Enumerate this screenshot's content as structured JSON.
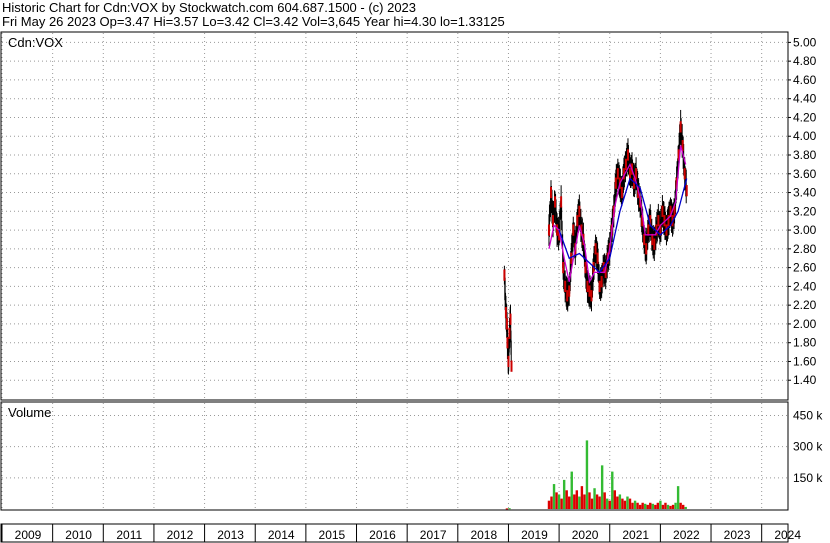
{
  "header": {
    "line1": "Historic Chart for Cdn:VOX by Stockwatch.com 604.687.1500 - (c) 2023",
    "line2": "Fri May 26 2023  Op=3.47  Hi=3.57  Lo=3.42  Cl=3.42  Vol=3,645  Year hi=4.30  lo=1.33125"
  },
  "chart_data": {
    "type": "line",
    "symbol_label": "Cdn:VOX",
    "volume_label": "Volume",
    "price_axis": {
      "ticks": [
        "5.00",
        "4.80",
        "4.60",
        "4.40",
        "4.20",
        "4.00",
        "3.80",
        "3.60",
        "3.40",
        "3.20",
        "3.00",
        "2.80",
        "2.60",
        "2.40",
        "2.20",
        "2.00",
        "1.80",
        "1.60",
        "1.40"
      ],
      "range": [
        1.2,
        5.1
      ]
    },
    "volume_axis": {
      "ticks": [
        "450 k",
        "300 k",
        "150 k"
      ],
      "range": [
        0,
        510000
      ]
    },
    "x_axis": {
      "years": [
        "2009",
        "2010",
        "2011",
        "2012",
        "2013",
        "2014",
        "2015",
        "2016",
        "2017",
        "2018",
        "2019",
        "2020",
        "2021",
        "2022",
        "2023",
        "2024"
      ],
      "range": [
        2009.0,
        2024.5
      ]
    },
    "colors": {
      "price": "#000000",
      "ma_short": "#cc00cc",
      "ma_long": "#0000cc",
      "vol_up": "#33bb33",
      "vol_down": "#dd0000",
      "frame": "#000000",
      "grid": "#999999"
    },
    "series": [
      {
        "role": "price",
        "points": [
          [
            2018.92,
            2.52
          ],
          [
            2018.95,
            2.12
          ],
          [
            2018.97,
            2.0
          ],
          [
            2018.98,
            1.8
          ],
          [
            2019.0,
            1.6
          ],
          [
            2019.02,
            1.9
          ],
          [
            2019.04,
            2.05
          ],
          [
            2019.06,
            1.55
          ],
          [
            2019.8,
            3.0
          ],
          [
            2019.84,
            3.4
          ],
          [
            2019.88,
            3.1
          ],
          [
            2019.92,
            3.3
          ],
          [
            2019.96,
            3.0
          ],
          [
            2020.0,
            2.95
          ],
          [
            2020.04,
            3.3
          ],
          [
            2020.08,
            2.6
          ],
          [
            2020.12,
            2.4
          ],
          [
            2020.16,
            2.3
          ],
          [
            2020.2,
            2.35
          ],
          [
            2020.24,
            2.7
          ],
          [
            2020.28,
            3.0
          ],
          [
            2020.32,
            2.8
          ],
          [
            2020.36,
            3.1
          ],
          [
            2020.4,
            3.2
          ],
          [
            2020.44,
            3.0
          ],
          [
            2020.48,
            2.9
          ],
          [
            2020.52,
            2.6
          ],
          [
            2020.56,
            2.4
          ],
          [
            2020.6,
            2.35
          ],
          [
            2020.64,
            2.3
          ],
          [
            2020.68,
            2.6
          ],
          [
            2020.72,
            2.8
          ],
          [
            2020.76,
            2.7
          ],
          [
            2020.8,
            2.4
          ],
          [
            2020.84,
            2.45
          ],
          [
            2020.88,
            2.6
          ],
          [
            2020.92,
            2.55
          ],
          [
            2020.96,
            2.7
          ],
          [
            2021.0,
            2.8
          ],
          [
            2021.04,
            3.0
          ],
          [
            2021.08,
            3.2
          ],
          [
            2021.12,
            3.5
          ],
          [
            2021.16,
            3.6
          ],
          [
            2021.2,
            3.5
          ],
          [
            2021.24,
            3.4
          ],
          [
            2021.28,
            3.6
          ],
          [
            2021.32,
            3.7
          ],
          [
            2021.36,
            3.8
          ],
          [
            2021.4,
            3.6
          ],
          [
            2021.44,
            3.65
          ],
          [
            2021.48,
            3.5
          ],
          [
            2021.52,
            3.6
          ],
          [
            2021.56,
            3.4
          ],
          [
            2021.6,
            3.3
          ],
          [
            2021.64,
            3.1
          ],
          [
            2021.68,
            2.9
          ],
          [
            2021.72,
            2.8
          ],
          [
            2021.76,
            3.0
          ],
          [
            2021.8,
            3.1
          ],
          [
            2021.84,
            2.9
          ],
          [
            2021.88,
            2.85
          ],
          [
            2021.92,
            3.0
          ],
          [
            2021.96,
            3.1
          ],
          [
            2022.0,
            3.0
          ],
          [
            2022.04,
            3.2
          ],
          [
            2022.08,
            3.1
          ],
          [
            2022.12,
            3.0
          ],
          [
            2022.16,
            3.1
          ],
          [
            2022.2,
            3.2
          ],
          [
            2022.24,
            3.1
          ],
          [
            2022.28,
            3.2
          ],
          [
            2022.32,
            3.5
          ],
          [
            2022.36,
            3.8
          ],
          [
            2022.4,
            4.1
          ],
          [
            2022.44,
            3.9
          ],
          [
            2022.48,
            3.6
          ],
          [
            2022.52,
            3.42
          ]
        ]
      },
      {
        "role": "ma_short",
        "points": [
          [
            2019.8,
            2.8
          ],
          [
            2019.9,
            3.05
          ],
          [
            2020.0,
            3.0
          ],
          [
            2020.1,
            2.7
          ],
          [
            2020.2,
            2.45
          ],
          [
            2020.3,
            2.75
          ],
          [
            2020.4,
            3.05
          ],
          [
            2020.5,
            2.85
          ],
          [
            2020.6,
            2.45
          ],
          [
            2020.7,
            2.55
          ],
          [
            2020.8,
            2.55
          ],
          [
            2020.9,
            2.55
          ],
          [
            2021.0,
            2.8
          ],
          [
            2021.1,
            3.25
          ],
          [
            2021.2,
            3.5
          ],
          [
            2021.3,
            3.6
          ],
          [
            2021.4,
            3.7
          ],
          [
            2021.5,
            3.55
          ],
          [
            2021.6,
            3.35
          ],
          [
            2021.7,
            2.95
          ],
          [
            2021.8,
            2.95
          ],
          [
            2021.9,
            2.95
          ],
          [
            2022.0,
            3.05
          ],
          [
            2022.1,
            3.1
          ],
          [
            2022.2,
            3.15
          ],
          [
            2022.3,
            3.3
          ],
          [
            2022.4,
            3.9
          ],
          [
            2022.5,
            3.7
          ]
        ]
      },
      {
        "role": "ma_long",
        "points": [
          [
            2020.0,
            3.0
          ],
          [
            2020.2,
            2.7
          ],
          [
            2020.4,
            2.75
          ],
          [
            2020.6,
            2.65
          ],
          [
            2020.8,
            2.55
          ],
          [
            2021.0,
            2.7
          ],
          [
            2021.2,
            3.2
          ],
          [
            2021.4,
            3.55
          ],
          [
            2021.6,
            3.45
          ],
          [
            2021.8,
            3.05
          ],
          [
            2022.0,
            2.95
          ],
          [
            2022.2,
            3.05
          ],
          [
            2022.35,
            3.2
          ],
          [
            2022.52,
            3.55
          ]
        ]
      }
    ],
    "volume": [
      [
        2018.97,
        3000,
        "down"
      ],
      [
        2019.02,
        4000,
        "up"
      ],
      [
        2019.8,
        40000,
        "down"
      ],
      [
        2019.85,
        60000,
        "down"
      ],
      [
        2019.9,
        120000,
        "up"
      ],
      [
        2019.95,
        80000,
        "down"
      ],
      [
        2020.0,
        70000,
        "up"
      ],
      [
        2020.05,
        50000,
        "down"
      ],
      [
        2020.1,
        140000,
        "up"
      ],
      [
        2020.15,
        90000,
        "down"
      ],
      [
        2020.2,
        60000,
        "down"
      ],
      [
        2020.25,
        180000,
        "up"
      ],
      [
        2020.3,
        70000,
        "down"
      ],
      [
        2020.35,
        90000,
        "down"
      ],
      [
        2020.4,
        60000,
        "up"
      ],
      [
        2020.45,
        110000,
        "down"
      ],
      [
        2020.5,
        70000,
        "down"
      ],
      [
        2020.55,
        330000,
        "up"
      ],
      [
        2020.6,
        80000,
        "down"
      ],
      [
        2020.65,
        50000,
        "down"
      ],
      [
        2020.7,
        100000,
        "up"
      ],
      [
        2020.75,
        70000,
        "down"
      ],
      [
        2020.8,
        60000,
        "down"
      ],
      [
        2020.85,
        210000,
        "up"
      ],
      [
        2020.9,
        80000,
        "down"
      ],
      [
        2020.95,
        50000,
        "up"
      ],
      [
        2021.0,
        40000,
        "down"
      ],
      [
        2021.05,
        180000,
        "up"
      ],
      [
        2021.1,
        90000,
        "down"
      ],
      [
        2021.15,
        60000,
        "down"
      ],
      [
        2021.2,
        70000,
        "up"
      ],
      [
        2021.25,
        50000,
        "down"
      ],
      [
        2021.3,
        40000,
        "down"
      ],
      [
        2021.35,
        60000,
        "up"
      ],
      [
        2021.4,
        50000,
        "down"
      ],
      [
        2021.45,
        30000,
        "down"
      ],
      [
        2021.5,
        40000,
        "up"
      ],
      [
        2021.55,
        30000,
        "down"
      ],
      [
        2021.6,
        20000,
        "down"
      ],
      [
        2021.65,
        30000,
        "down"
      ],
      [
        2021.7,
        25000,
        "up"
      ],
      [
        2021.75,
        20000,
        "down"
      ],
      [
        2021.8,
        30000,
        "down"
      ],
      [
        2021.85,
        25000,
        "up"
      ],
      [
        2021.9,
        20000,
        "down"
      ],
      [
        2021.95,
        30000,
        "down"
      ],
      [
        2022.0,
        40000,
        "up"
      ],
      [
        2022.05,
        20000,
        "down"
      ],
      [
        2022.1,
        30000,
        "down"
      ],
      [
        2022.15,
        20000,
        "up"
      ],
      [
        2022.2,
        15000,
        "down"
      ],
      [
        2022.25,
        20000,
        "down"
      ],
      [
        2022.3,
        30000,
        "up"
      ],
      [
        2022.35,
        110000,
        "up"
      ],
      [
        2022.4,
        30000,
        "down"
      ],
      [
        2022.45,
        20000,
        "down"
      ],
      [
        2022.5,
        10000,
        "up"
      ]
    ]
  }
}
